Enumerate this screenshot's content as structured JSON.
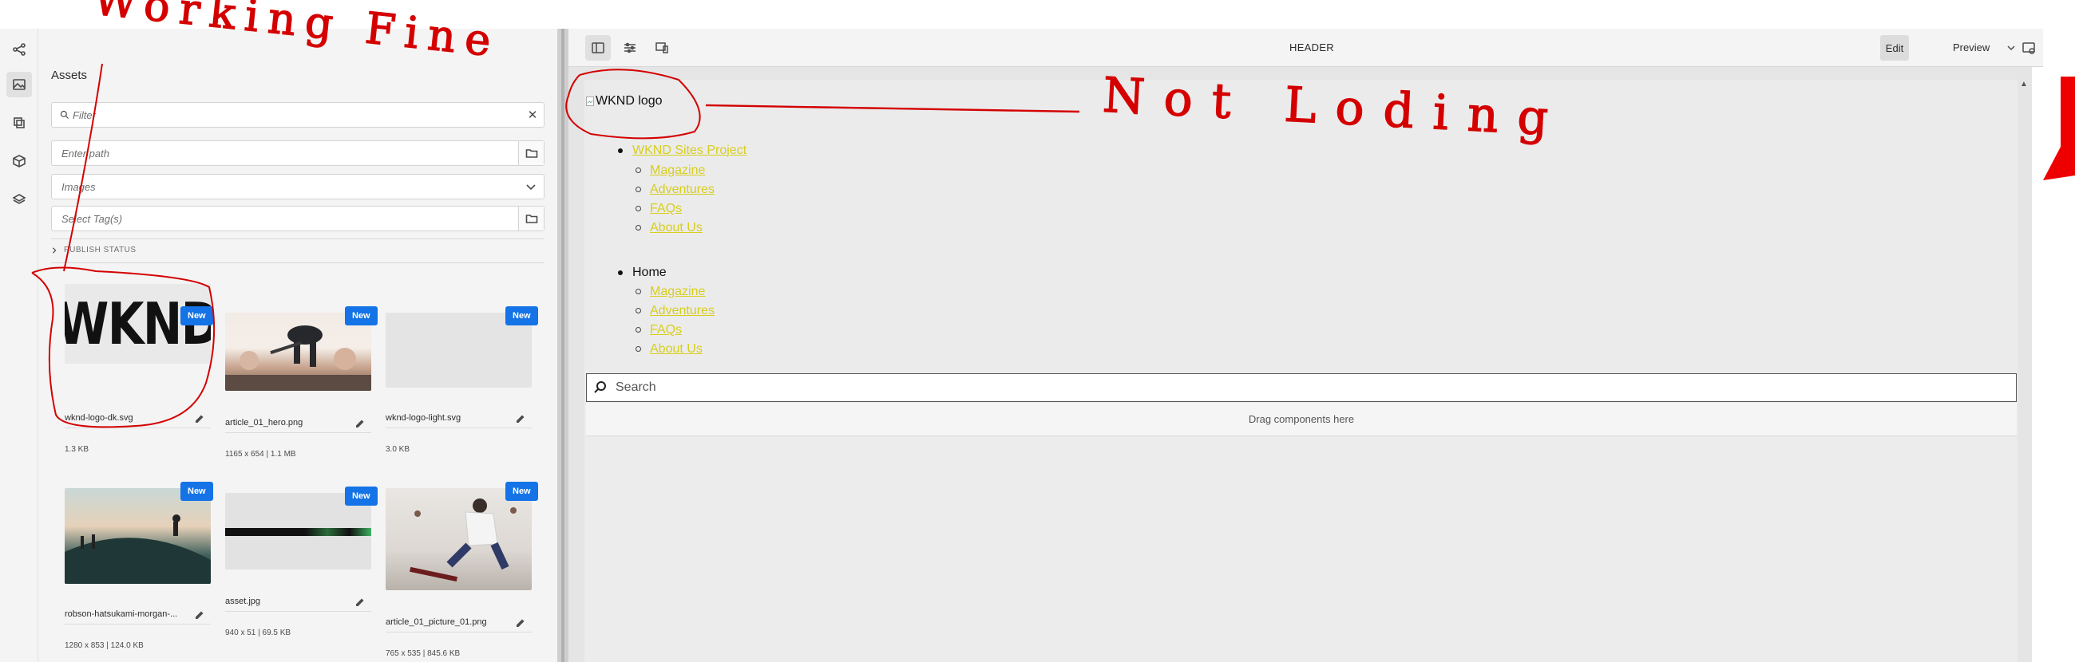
{
  "panel": {
    "title": "Assets",
    "filter_placeholder": "Filter",
    "path_placeholder": "Enter path",
    "type_value": "Images",
    "tags_placeholder": "Select Tag(s)",
    "publish_status": "PUBLISH STATUS"
  },
  "assets": [
    {
      "name": "wknd-logo-dk.svg",
      "meta": "1.3 KB",
      "badge": "New",
      "thumb_text": "WKND"
    },
    {
      "name": "article_01_hero.png",
      "meta": "1165 x 654 | 1.1 MB",
      "badge": "New"
    },
    {
      "name": "wknd-logo-light.svg",
      "meta": "3.0 KB",
      "badge": "New"
    },
    {
      "name": "robson-hatsukami-morgan-...",
      "meta": "1280 x 853 | 124.0 KB",
      "badge": "New"
    },
    {
      "name": "asset.jpg",
      "meta": "940 x 51 | 69.5 KB",
      "badge": "New"
    },
    {
      "name": "article_01_picture_01.png",
      "meta": "765 x 535 | 845.6 KB",
      "badge": "New"
    }
  ],
  "toolbar": {
    "title": "HEADER",
    "edit_label": "Edit",
    "preview_label": "Preview"
  },
  "page": {
    "logo_alt": "WKND logo",
    "nav1_label": "WKND Sites Project",
    "nav1_items": [
      "Magazine",
      "Adventures",
      "FAQs",
      "About Us"
    ],
    "nav2_label": "Home",
    "nav2_items": [
      "Magazine",
      "Adventures",
      "FAQs",
      "About Us"
    ],
    "search_placeholder": "Search",
    "drop_text": "Drag components here"
  },
  "annotations": {
    "working": "Working Fine",
    "not_loading": "Not Loding"
  },
  "colors": {
    "accent_blue": "#1473e6",
    "link_yellow": "#d7ce1f",
    "annotation_red": "#d40000"
  }
}
